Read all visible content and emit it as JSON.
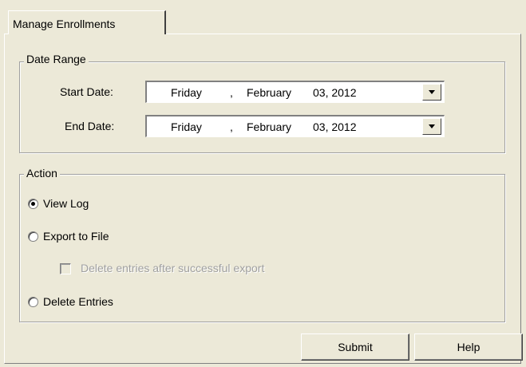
{
  "tabs": [
    {
      "label": "Manage Enrollments"
    }
  ],
  "date_range": {
    "title": "Date Range",
    "start": {
      "label": "Start Date:",
      "day": "Friday",
      "sep": ",",
      "month": "February",
      "date": "03, 2012"
    },
    "end": {
      "label": "End Date:",
      "day": "Friday",
      "sep": ",",
      "month": "February",
      "date": "03, 2012"
    }
  },
  "action": {
    "title": "Action",
    "options": [
      {
        "label": "View Log",
        "checked": true
      },
      {
        "label": "Export to File",
        "checked": false
      },
      {
        "label": "Delete Entries",
        "checked": false
      }
    ],
    "delete_after_export": {
      "label": "Delete entries after successful export",
      "checked": false,
      "enabled": false
    }
  },
  "buttons": {
    "submit": "Submit",
    "help": "Help"
  }
}
